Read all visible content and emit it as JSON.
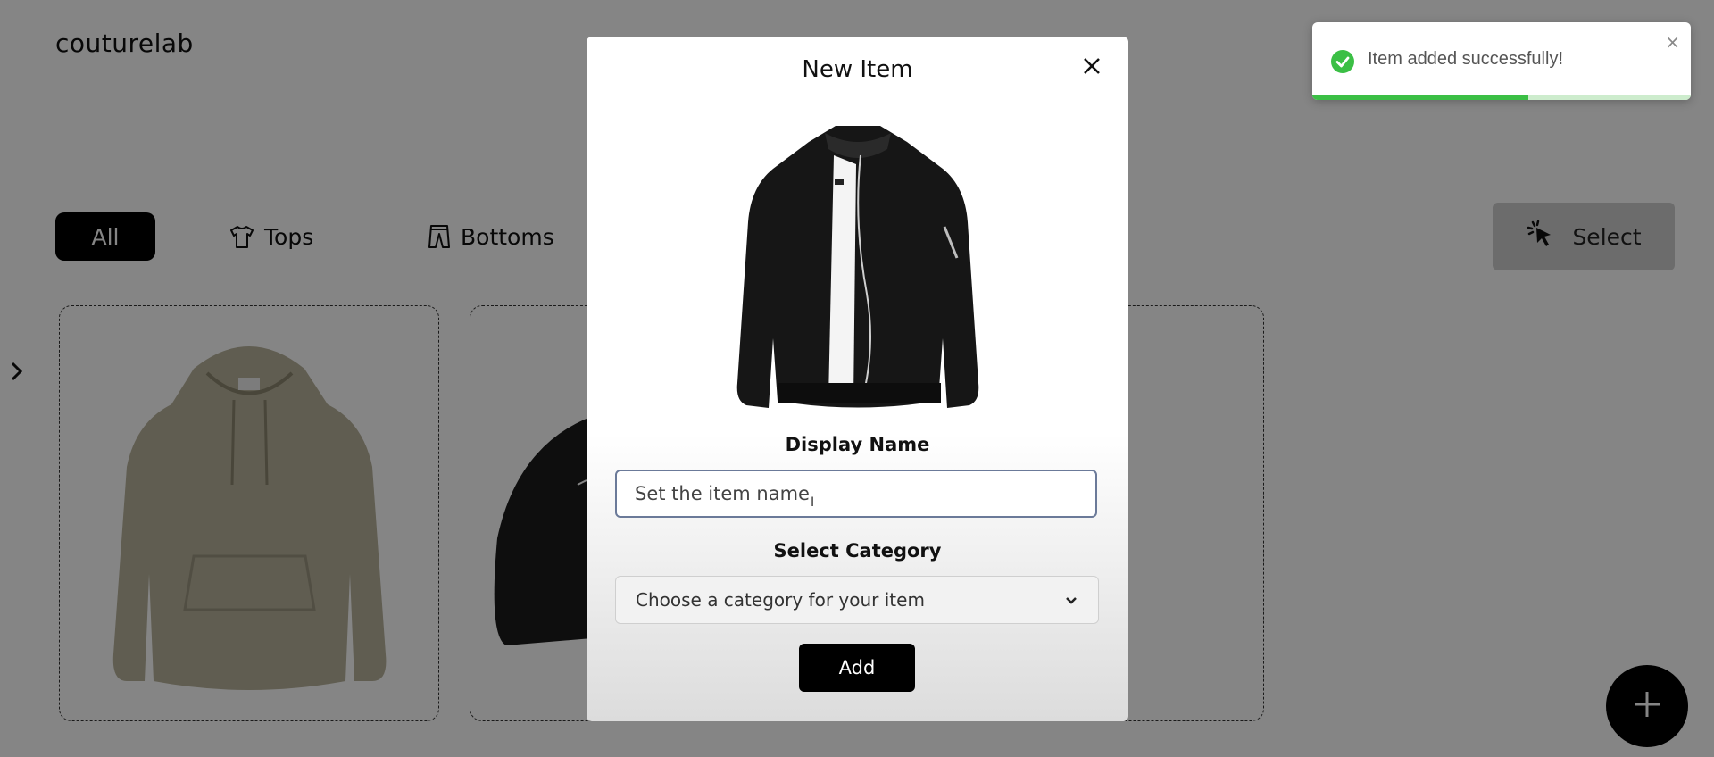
{
  "app": {
    "logo": "couturelab"
  },
  "filters": {
    "all_label": "All",
    "tops_label": "Tops",
    "bottoms_label": "Bottoms"
  },
  "toolbar": {
    "select_label": "Select"
  },
  "modal": {
    "title": "New Item",
    "display_name_label": "Display Name",
    "name_placeholder": "Set the item name",
    "name_value": "",
    "category_label": "Select Category",
    "category_value": "Choose a category for your item",
    "add_label": "Add"
  },
  "toast": {
    "message": "Item added successfully!",
    "progress": 0.57,
    "close_glyph": "×",
    "success_color": "#3bbf45"
  },
  "icons": {
    "close": "close-icon",
    "check": "check-circle-icon",
    "chevron_right": "chevron-right-icon",
    "chevron_down": "chevron-down-icon",
    "plus": "plus-icon",
    "cursor_click": "cursor-click-icon",
    "shirt": "shirt-icon",
    "pants": "pants-icon"
  },
  "colors": {
    "accent": "#000000",
    "overlay": "rgba(0,0,0,0.48)"
  }
}
